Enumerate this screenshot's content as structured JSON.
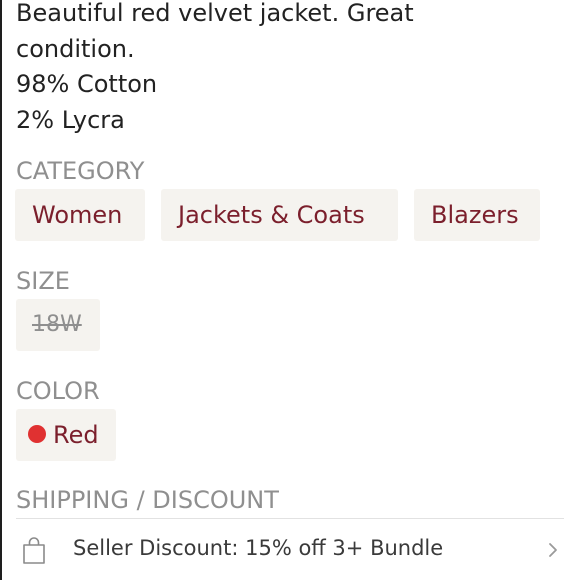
{
  "listing": {
    "description_lines": [
      "Beautiful red velvet jacket. Great",
      "condition.",
      "98% Cotton",
      "2% Lycra"
    ]
  },
  "category": {
    "heading": "CATEGORY",
    "tags": [
      "Women",
      "Jackets & Coats",
      "Blazers"
    ]
  },
  "size": {
    "heading": "SIZE",
    "value": "18W"
  },
  "color": {
    "heading": "COLOR",
    "value": "Red",
    "swatch_color": "#e03131"
  },
  "shipping": {
    "heading": "SHIPPING / DISCOUNT",
    "discount_text": "Seller Discount: 15% off 3+ Bundle",
    "icon": "shopping-bag-icon",
    "chevron_icon": "chevron-right-icon"
  },
  "theme": {
    "tag_text_color": "#7b1f2c",
    "chip_background": "#f5f3ef",
    "heading_color": "#8f8f8f"
  }
}
